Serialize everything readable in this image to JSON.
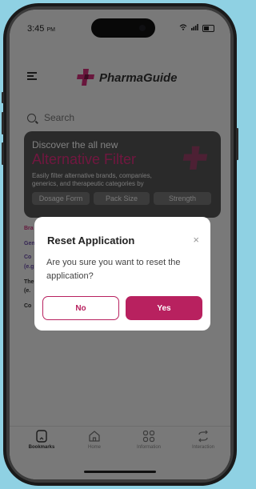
{
  "status_bar": {
    "time": "3:45",
    "period": "PM"
  },
  "header": {
    "app_name": "PharmaGuide"
  },
  "search": {
    "placeholder": "Search"
  },
  "banner": {
    "subtitle": "Discover the all new",
    "title": "Alternative Filter",
    "description": "Easily filter alternative brands, companies, generics, and therapeutic categories by",
    "chips": [
      "Dosage Form",
      "Pack Size",
      "Strength"
    ]
  },
  "background_rows": [
    {
      "text": "Bra",
      "color": "#c8327a"
    },
    {
      "text": "Gen",
      "color": "#6a4aa8"
    },
    {
      "text": "Co",
      "color": "#6a4aa8"
    },
    {
      "text": "(e.g",
      "color": "#6a4aa8"
    },
    {
      "text": "The",
      "color": "#333333"
    },
    {
      "text": "(e.",
      "color": "#333333"
    },
    {
      "text": "Co",
      "color": "#333333"
    }
  ],
  "bottom_nav": {
    "items": [
      {
        "label": "Bookmarks",
        "icon": "bookmark-icon",
        "active": true
      },
      {
        "label": "Home",
        "icon": "home-icon",
        "active": false
      },
      {
        "label": "Information",
        "icon": "grid-icon",
        "active": false
      },
      {
        "label": "Interaction",
        "icon": "refresh-icon",
        "active": false
      }
    ]
  },
  "modal": {
    "title": "Reset Application",
    "close_symbol": "×",
    "message": "Are you sure you want to reset the application?",
    "no_label": "No",
    "yes_label": "Yes"
  },
  "colors": {
    "accent": "#b8215f",
    "brand_pink": "#e02f7e",
    "phone_bg": "#8fd1e3"
  }
}
